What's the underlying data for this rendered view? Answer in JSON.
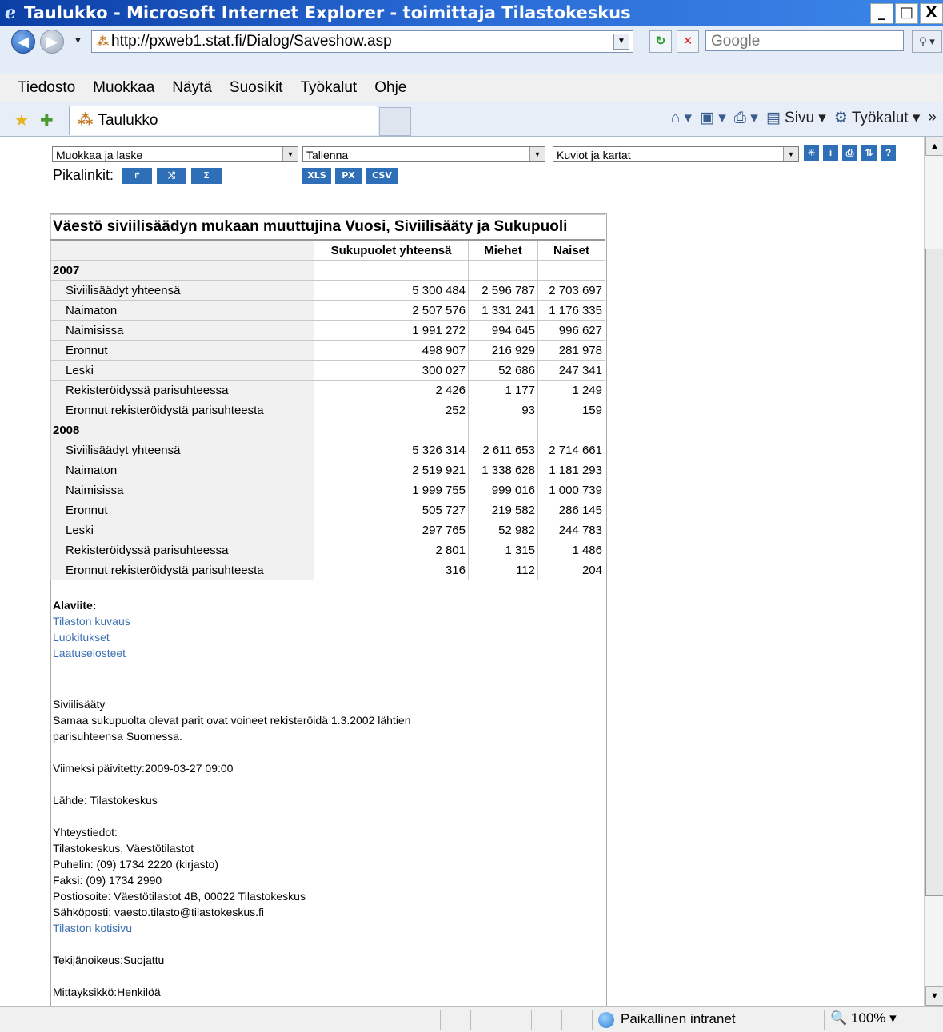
{
  "window": {
    "title": "Taulukko - Microsoft Internet Explorer - toimittaja Tilastokeskus",
    "controls": [
      "_",
      "□",
      "X"
    ]
  },
  "address": {
    "url": "http://pxweb1.stat.fi/Dialog/Saveshow.asp",
    "search_placeholder": "Google"
  },
  "menu": {
    "items": [
      "Tiedosto",
      "Muokkaa",
      "Näytä",
      "Suosikit",
      "Työkalut",
      "Ohje"
    ]
  },
  "tabs": {
    "active_label": "Taulukko",
    "commands": [
      "Sivu",
      "Työkalut"
    ]
  },
  "toolbar": {
    "edit_select": "Muokkaa ja laske",
    "save_select": "Tallenna",
    "charts_select": "Kuviot ja kartat",
    "pikalinkit_label": "Pikalinkit:",
    "export_buttons": [
      "XLS",
      "PX",
      "CSV"
    ],
    "icon_buttons": [
      "*",
      "i",
      "print",
      "sort",
      "?"
    ]
  },
  "table": {
    "caption": "Väestö siviilisäädyn mukaan muuttujina Vuosi, Siviilisääty ja Sukupuoli",
    "columns": [
      "Sukupuolet yhteensä",
      "Miehet",
      "Naiset"
    ],
    "groups": [
      {
        "year": "2007",
        "rows": [
          {
            "label": "Siviilisäädyt yhteensä",
            "values": [
              "5 300 484",
              "2 596 787",
              "2 703 697"
            ]
          },
          {
            "label": "Naimaton",
            "values": [
              "2 507 576",
              "1 331 241",
              "1 176 335"
            ]
          },
          {
            "label": "Naimisissa",
            "values": [
              "1 991 272",
              "994 645",
              "996 627"
            ]
          },
          {
            "label": "Eronnut",
            "values": [
              "498 907",
              "216 929",
              "281 978"
            ]
          },
          {
            "label": "Leski",
            "values": [
              "300 027",
              "52 686",
              "247 341"
            ]
          },
          {
            "label": "Rekisteröidyssä parisuhteessa",
            "values": [
              "2 426",
              "1 177",
              "1 249"
            ]
          },
          {
            "label": "Eronnut rekisteröidystä parisuhteesta",
            "values": [
              "252",
              "93",
              "159"
            ]
          }
        ]
      },
      {
        "year": "2008",
        "rows": [
          {
            "label": "Siviilisäädyt yhteensä",
            "values": [
              "5 326 314",
              "2 611 653",
              "2 714 661"
            ]
          },
          {
            "label": "Naimaton",
            "values": [
              "2 519 921",
              "1 338 628",
              "1 181 293"
            ]
          },
          {
            "label": "Naimisissa",
            "values": [
              "1 999 755",
              "999 016",
              "1 000 739"
            ]
          },
          {
            "label": "Eronnut",
            "values": [
              "505 727",
              "219 582",
              "286 145"
            ]
          },
          {
            "label": "Leski",
            "values": [
              "297 765",
              "52 982",
              "244 783"
            ]
          },
          {
            "label": "Rekisteröidyssä parisuhteessa",
            "values": [
              "2 801",
              "1 315",
              "1 486"
            ]
          },
          {
            "label": "Eronnut rekisteröidystä parisuhteesta",
            "values": [
              "316",
              "112",
              "204"
            ]
          }
        ]
      }
    ]
  },
  "footer": {
    "alaviite_label": "Alaviite:",
    "links": [
      "Tilaston kuvaus",
      "Luokitukset",
      "Laatuselosteet"
    ],
    "note_title": "Siviilisääty",
    "note_line1": "Samaa sukupuolta olevat parit ovat voineet rekisteröidä 1.3.2002 lähtien",
    "note_line2": "parisuhteensa Suomessa.",
    "updated": "Viimeksi päivitetty:2009-03-27 09:00",
    "source": "Lähde: Tilastokeskus",
    "contact_title": "Yhteystiedot:",
    "contact_org": "Tilastokeskus, Väestötilastot",
    "phone": "Puhelin: (09) 1734 2220 (kirjasto)",
    "fax": "Faksi: (09) 1734 2990",
    "postal": "Postiosoite: Väestötilastot 4B, 00022 Tilastokeskus",
    "email": "Sähköposti: vaesto.tilasto@tilastokeskus.fi",
    "homepage_link": "Tilaston kotisivu",
    "copyright": "Tekijänoikeus:Suojattu",
    "unit": "Mittayksikkö:Henkilöä"
  },
  "status": {
    "zone": "Paikallinen intranet",
    "zoom": "100%"
  }
}
